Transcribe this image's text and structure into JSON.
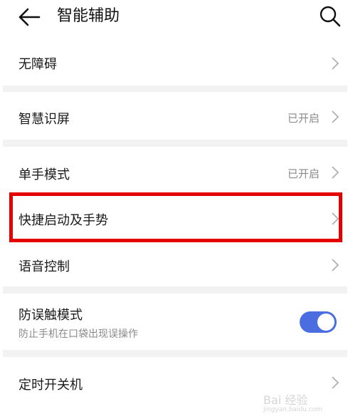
{
  "header": {
    "title": "智能辅助",
    "back_icon": "back-arrow-icon",
    "search_icon": "search-icon"
  },
  "rows": [
    {
      "label": "无障碍",
      "status": ""
    },
    {
      "label": "智慧识屏",
      "status": "已开启"
    },
    {
      "label": "单手模式",
      "status": "已开启"
    },
    {
      "label": "快捷启动及手势",
      "status": ""
    },
    {
      "label": "语音控制",
      "status": ""
    },
    {
      "label": "防误触模式",
      "sublabel": "防止手机在口袋出现误操作",
      "toggle_on": true
    },
    {
      "label": "定时开关机",
      "status": ""
    }
  ],
  "colors": {
    "highlight": "#e50000",
    "toggle": "#4a6ee0",
    "divider": "#f2f2f2"
  },
  "watermark": {
    "text": "Bai 经验",
    "url": "jingyan.baidu.com"
  }
}
